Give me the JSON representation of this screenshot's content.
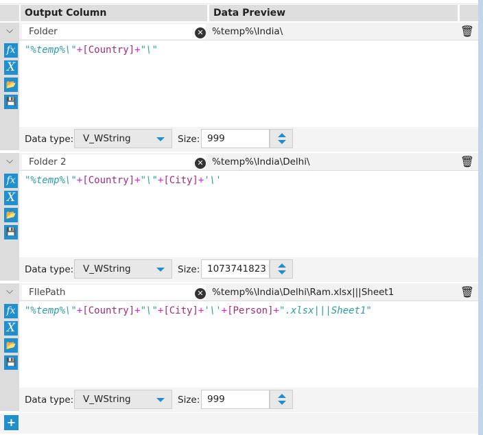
{
  "header": {
    "output_column": "Output Column",
    "data_preview": "Data Preview"
  },
  "labels": {
    "data_type": "Data type:",
    "size": "Size:"
  },
  "icons": {
    "expand": "chevron-down-icon",
    "clear": "clear-icon",
    "delete": "trash-icon",
    "functions": "fx-icon",
    "variables": "x-icon",
    "open": "folder-open-icon",
    "save": "save-icon",
    "add": "plus-icon"
  },
  "colors": {
    "accent": "#1f8fcd",
    "string": "#2b9ea6",
    "operator": "#e020d8",
    "field": "#a32a7c"
  },
  "rows": [
    {
      "name": "Folder",
      "preview": "%temp%\\India\\",
      "data_type": "V_WString",
      "size": "999",
      "expr": [
        {
          "t": "s",
          "v": "\"%temp%\\\""
        },
        {
          "t": "op",
          "v": "+"
        },
        {
          "t": "f",
          "v": "[Country]"
        },
        {
          "t": "op",
          "v": "+"
        },
        {
          "t": "s",
          "v": "\"\\\""
        }
      ]
    },
    {
      "name": "Folder 2",
      "preview": "%temp%\\India\\Delhi\\",
      "data_type": "V_WString",
      "size": "1073741823",
      "expr": [
        {
          "t": "s",
          "v": "\"%temp%\\\""
        },
        {
          "t": "op",
          "v": "+"
        },
        {
          "t": "f",
          "v": "[Country]"
        },
        {
          "t": "op",
          "v": "+"
        },
        {
          "t": "s",
          "v": "\"\\\""
        },
        {
          "t": "op",
          "v": "+"
        },
        {
          "t": "f",
          "v": "[City]"
        },
        {
          "t": "op",
          "v": "+"
        },
        {
          "t": "s",
          "v": "'\\'"
        }
      ]
    },
    {
      "name": "FIlePath",
      "preview": "%temp%\\India\\Delhi\\Ram.xlsx|||Sheet1",
      "data_type": "V_WString",
      "size": "999",
      "expr": [
        {
          "t": "s",
          "v": "\"%temp%\\\""
        },
        {
          "t": "op",
          "v": "+"
        },
        {
          "t": "f",
          "v": "[Country]"
        },
        {
          "t": "op",
          "v": "+"
        },
        {
          "t": "s",
          "v": "\"\\\""
        },
        {
          "t": "op",
          "v": "+"
        },
        {
          "t": "f",
          "v": "[City]"
        },
        {
          "t": "op",
          "v": "+"
        },
        {
          "t": "s",
          "v": "'\\'"
        },
        {
          "t": "op",
          "v": "+"
        },
        {
          "t": "f",
          "v": "[Person]"
        },
        {
          "t": "op",
          "v": "+"
        },
        {
          "t": "s",
          "v": "\".xlsx|||Sheet1\""
        }
      ]
    }
  ]
}
